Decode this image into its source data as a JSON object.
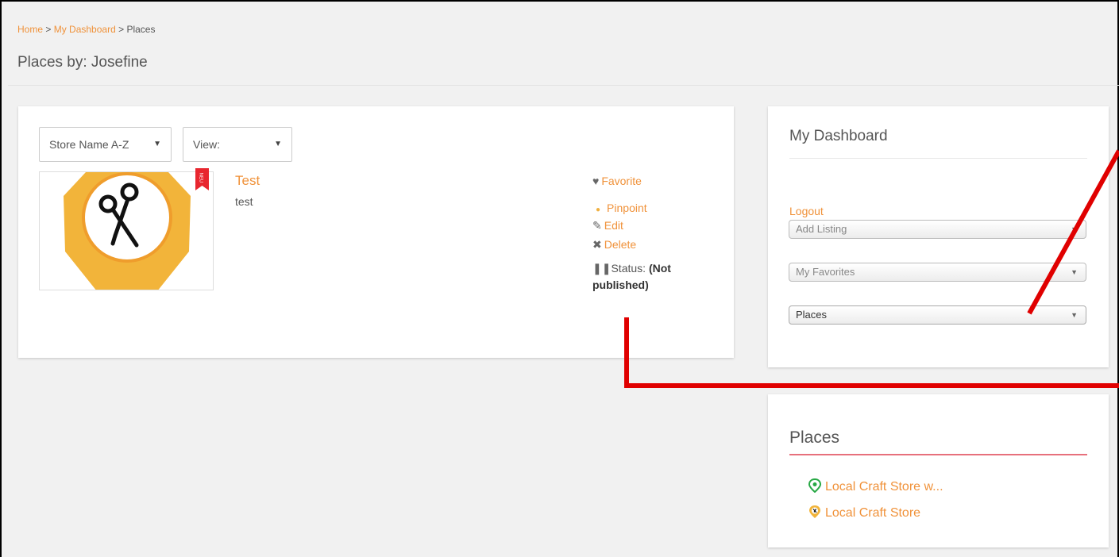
{
  "breadcrumb": {
    "home": "Home",
    "sep1": " > ",
    "dashboard": "My Dashboard",
    "sep2": " > ",
    "current": "Places"
  },
  "page_title": "Places by: Josefine",
  "listing_controls": {
    "sort_value": "Store Name A-Z",
    "view_value": "View:"
  },
  "listing": {
    "title": "Test",
    "description": "test",
    "badge": "NEU",
    "actions": {
      "favorite": "Favorite",
      "pinpoint": "Pinpoint",
      "edit": "Edit",
      "delete": "Delete"
    },
    "status_label": "Status:",
    "status_value": "(Not published)"
  },
  "dashboard": {
    "title": "My Dashboard",
    "logout": "Logout",
    "selects": [
      "Add Listing",
      "My Favorites",
      "Places"
    ]
  },
  "places_widget": {
    "title": "Places",
    "items": [
      "Local Craft Store w...",
      "Local Craft Store"
    ]
  },
  "colors": {
    "accent": "#f0923a",
    "annotation": "#e00000",
    "places_rule": "#e7707c"
  }
}
